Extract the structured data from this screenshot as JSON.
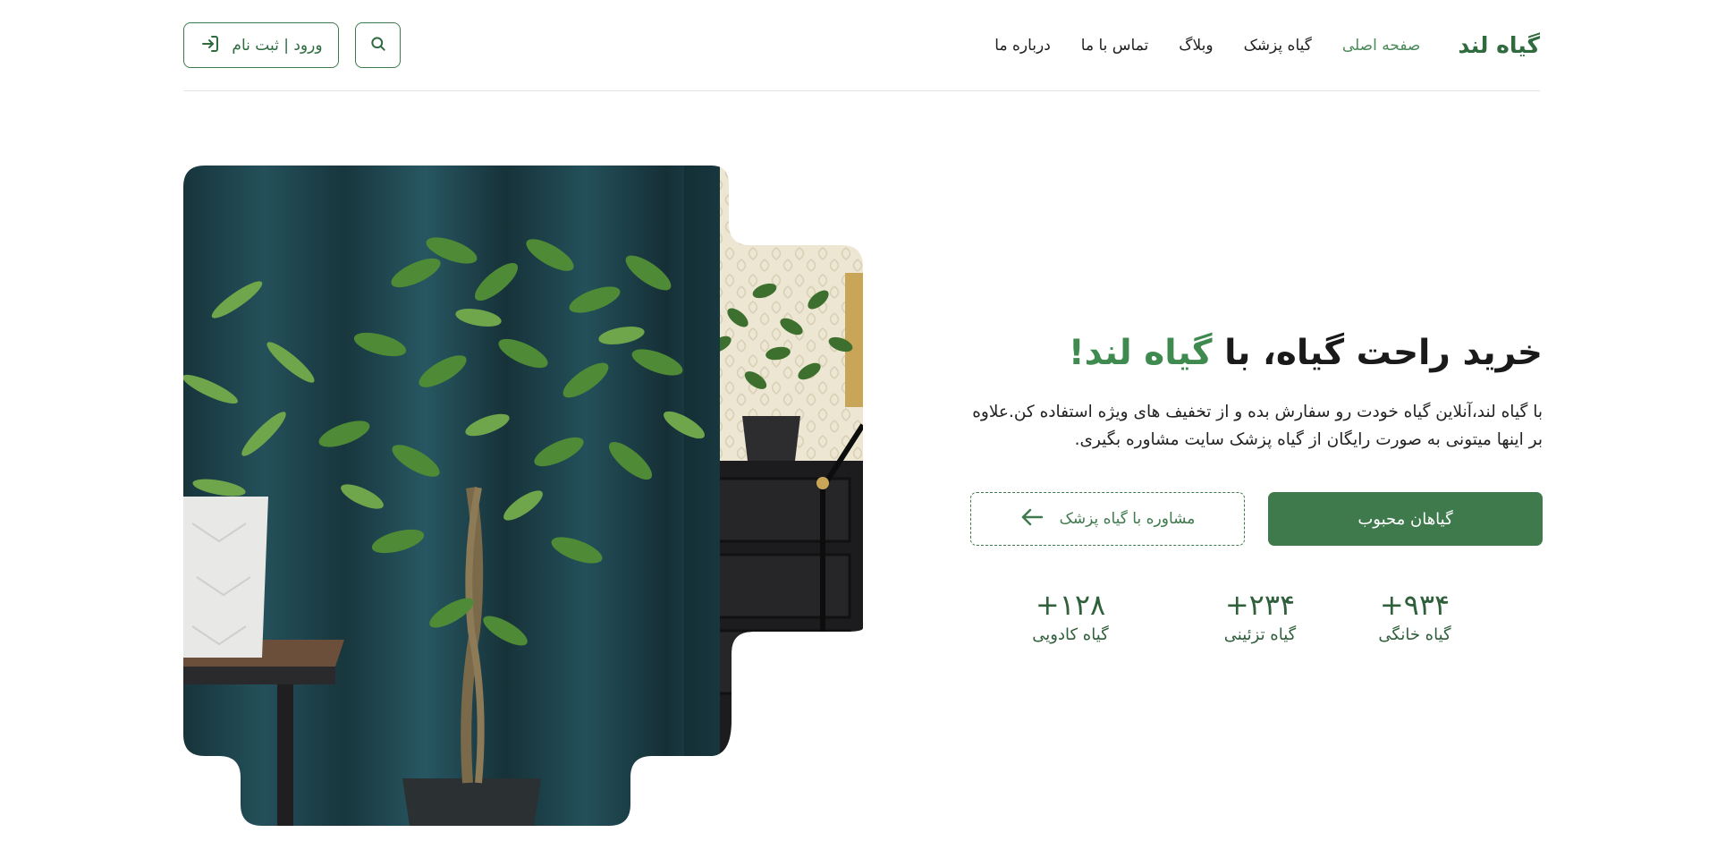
{
  "header": {
    "logo": "گیاه لند",
    "nav": [
      {
        "label": "صفحه اصلی",
        "active": true
      },
      {
        "label": "گیاه پزشک",
        "active": false
      },
      {
        "label": "وبلاگ",
        "active": false
      },
      {
        "label": "تماس با ما",
        "active": false
      },
      {
        "label": "درباره ما",
        "active": false
      }
    ],
    "login_label": "ورود | ثبت نام",
    "search_icon": "search-icon",
    "login_icon": "login-icon"
  },
  "hero": {
    "title_prefix": "خرید راحت گیاه، با",
    "title_accent": "گیاه لند!",
    "description": "با گیاه لند،آنلاین گیاه خودت رو سفارش بده و از تخفیف های ویژه استفاده کن.علاوه بر اینها میتونی به صورت رایگان از گیاه پزشک سایت مشاوره بگیری.",
    "primary_button": "گیاهان محبوب",
    "secondary_button": "مشاوره با گیاه پزشک",
    "secondary_icon": "arrow-left-icon"
  },
  "stats": [
    {
      "value": "+۹۳۴",
      "label": "گیاه خانگی"
    },
    {
      "value": "+۲۳۴",
      "label": "گیاه تزئینی"
    },
    {
      "value": "+۱۲۸",
      "label": "گیاه کادویی"
    }
  ],
  "colors": {
    "brand": "#3e7a4c",
    "accent_text": "#3f8a4f",
    "stat_text": "#2f5f3b",
    "curtain": "#1e3d45",
    "wallpaper": "#e9e3cf"
  }
}
